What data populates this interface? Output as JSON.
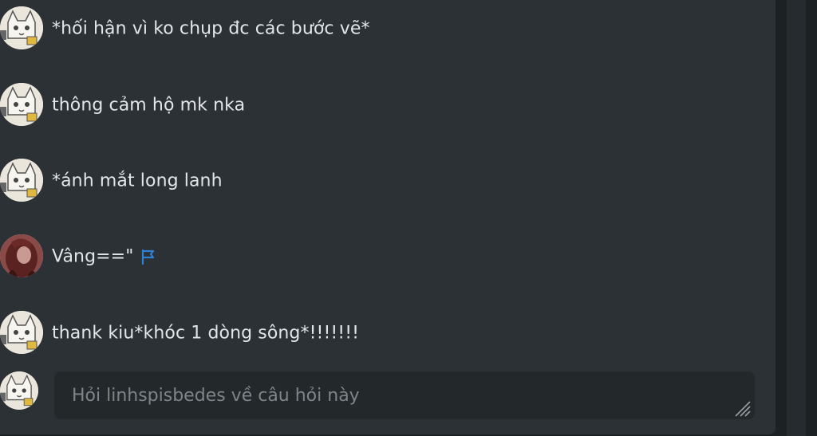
{
  "messages": [
    {
      "text": "*hối hận vì ko chụp đc các bước vẽ*",
      "avatar": "cat-sketch-avatar"
    },
    {
      "text": "thông cảm hộ mk nka",
      "avatar": "cat-sketch-avatar"
    },
    {
      "text": "*ánh mắt long lanh",
      "avatar": "cat-sketch-avatar"
    },
    {
      "text": "Vâng==\"",
      "avatar": "dark-red-hair-avatar",
      "flag": true
    },
    {
      "text": "thank kiu*khóc 1 dòng sông*!!!!!!!",
      "avatar": "cat-sketch-avatar"
    }
  ],
  "composer": {
    "placeholder": "Hỏi linhspisbedes về câu hỏi này",
    "value": ""
  },
  "colors": {
    "background": "#2b3135",
    "outer": "#1c2124",
    "text": "#e3e6e8",
    "placeholder": "#7d858a",
    "flag": "#2f80d1"
  }
}
